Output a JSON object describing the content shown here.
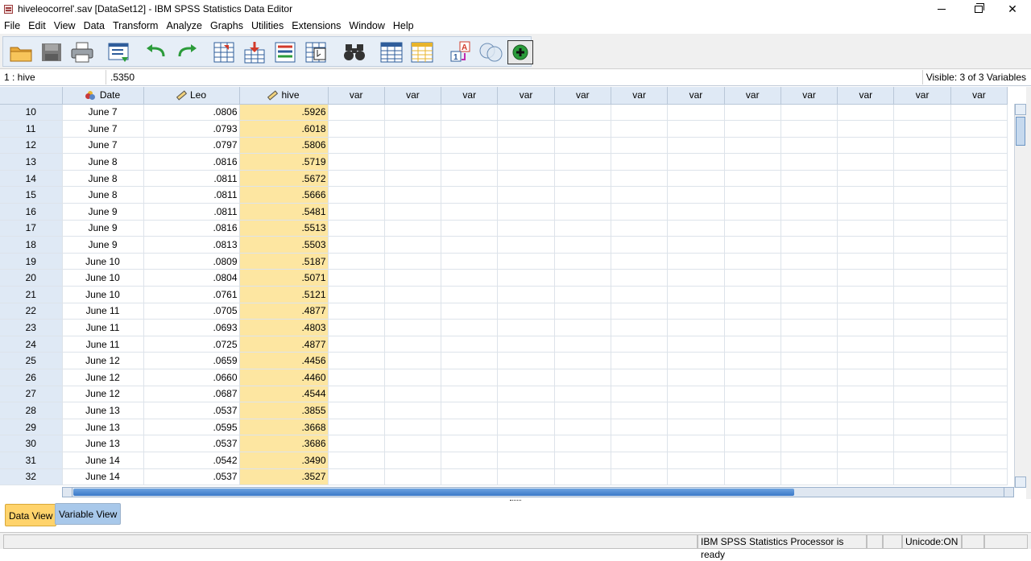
{
  "window": {
    "title": "hiveleocorrel'.sav [DataSet12] - IBM SPSS Statistics Data Editor"
  },
  "menu": [
    "File",
    "Edit",
    "View",
    "Data",
    "Transform",
    "Analyze",
    "Graphs",
    "Utilities",
    "Extensions",
    "Window",
    "Help"
  ],
  "toolbar": {
    "icons": [
      "open-folder-icon",
      "save-disk-icon",
      "print-icon",
      "recall-dialog-icon",
      "undo-icon",
      "redo-icon",
      "goto-case-icon",
      "goto-variable-icon",
      "variables-icon",
      "run-descriptives-icon",
      "find-binoculars-icon",
      "insert-cases-icon",
      "insert-variable-icon",
      "value-labels-icon",
      "use-variable-sets-icon",
      "show-all-variables-icon"
    ]
  },
  "refbar": {
    "cell_ref": "1 : hive",
    "cell_value": ".5350",
    "visible": "Visible: 3 of 3 Variables"
  },
  "grid": {
    "columns": [
      "Date",
      "Leo",
      "hive"
    ],
    "empty_column_label": "var",
    "empty_columns": [
      "var",
      "var",
      "var",
      "var",
      "var",
      "var",
      "var",
      "var",
      "var",
      "var",
      "var",
      "var"
    ],
    "rows": [
      {
        "n": "10",
        "date": "June 7",
        "leo": ".0806",
        "hive": ".5926"
      },
      {
        "n": "11",
        "date": "June 7",
        "leo": ".0793",
        "hive": ".6018"
      },
      {
        "n": "12",
        "date": "June 7",
        "leo": ".0797",
        "hive": ".5806"
      },
      {
        "n": "13",
        "date": "June 8",
        "leo": ".0816",
        "hive": ".5719"
      },
      {
        "n": "14",
        "date": "June 8",
        "leo": ".0811",
        "hive": ".5672"
      },
      {
        "n": "15",
        "date": "June 8",
        "leo": ".0811",
        "hive": ".5666"
      },
      {
        "n": "16",
        "date": "June 9",
        "leo": ".0811",
        "hive": ".5481"
      },
      {
        "n": "17",
        "date": "June 9",
        "leo": ".0816",
        "hive": ".5513"
      },
      {
        "n": "18",
        "date": "June 9",
        "leo": ".0813",
        "hive": ".5503"
      },
      {
        "n": "19",
        "date": "June 10",
        "leo": ".0809",
        "hive": ".5187"
      },
      {
        "n": "20",
        "date": "June 10",
        "leo": ".0804",
        "hive": ".5071"
      },
      {
        "n": "21",
        "date": "June 10",
        "leo": ".0761",
        "hive": ".5121"
      },
      {
        "n": "22",
        "date": "June 11",
        "leo": ".0705",
        "hive": ".4877"
      },
      {
        "n": "23",
        "date": "June 11",
        "leo": ".0693",
        "hive": ".4803"
      },
      {
        "n": "24",
        "date": "June 11",
        "leo": ".0725",
        "hive": ".4877"
      },
      {
        "n": "25",
        "date": "June 12",
        "leo": ".0659",
        "hive": ".4456"
      },
      {
        "n": "26",
        "date": "June 12",
        "leo": ".0660",
        "hive": ".4460"
      },
      {
        "n": "27",
        "date": "June 12",
        "leo": ".0687",
        "hive": ".4544"
      },
      {
        "n": "28",
        "date": "June 13",
        "leo": ".0537",
        "hive": ".3855"
      },
      {
        "n": "29",
        "date": "June 13",
        "leo": ".0595",
        "hive": ".3668"
      },
      {
        "n": "30",
        "date": "June 13",
        "leo": ".0537",
        "hive": ".3686"
      },
      {
        "n": "31",
        "date": "June 14",
        "leo": ".0542",
        "hive": ".3490"
      },
      {
        "n": "32",
        "date": "June 14",
        "leo": ".0537",
        "hive": ".3527"
      }
    ]
  },
  "tabs": {
    "data_view": "Data View",
    "variable_view": "Variable View"
  },
  "status": {
    "processor": "IBM SPSS Statistics Processor is ready",
    "unicode": "Unicode:ON"
  },
  "colors": {
    "selected_column": "#fde6a1",
    "header_bg": "#dfe9f5",
    "active_tab": "#ffd36b"
  }
}
